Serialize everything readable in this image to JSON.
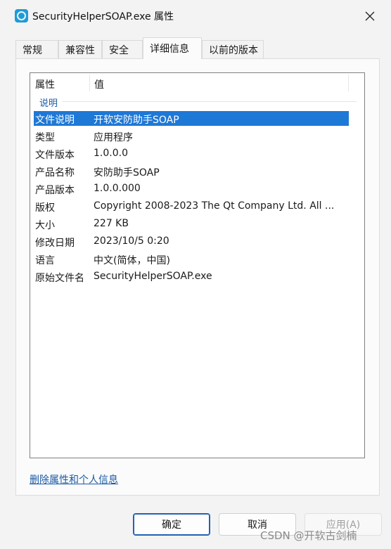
{
  "window": {
    "title": "SecurityHelperSOAP.exe 属性",
    "app_icon": "app-icon",
    "close_icon": "close-icon"
  },
  "tabs": [
    {
      "label": "常规"
    },
    {
      "label": "兼容性"
    },
    {
      "label": "安全"
    },
    {
      "label": "详细信息",
      "active": true
    },
    {
      "label": "以前的版本"
    }
  ],
  "details": {
    "columns": [
      "属性",
      "值"
    ],
    "group": "说明",
    "rows": [
      {
        "key": "文件说明",
        "value": "开软安防助手SOAP",
        "selected": true
      },
      {
        "key": "类型",
        "value": "应用程序"
      },
      {
        "key": "文件版本",
        "value": "1.0.0.0"
      },
      {
        "key": "产品名称",
        "value": "安防助手SOAP"
      },
      {
        "key": "产品版本",
        "value": "1.0.0.000"
      },
      {
        "key": "版权",
        "value": "Copyright 2008-2023 The Qt Company Ltd. All ..."
      },
      {
        "key": "大小",
        "value": "227 KB"
      },
      {
        "key": "修改日期",
        "value": "2023/10/5 0:20"
      },
      {
        "key": "语言",
        "value": "中文(简体，中国)"
      },
      {
        "key": "原始文件名",
        "value": "SecurityHelperSOAP.exe"
      }
    ]
  },
  "remove_link": "删除属性和个人信息",
  "buttons": {
    "ok": "确定",
    "cancel": "取消",
    "apply": "应用(A)"
  },
  "watermark": "CSDN @开软古剑楠",
  "colors": {
    "selection": "#1e78d6",
    "link": "#1a5aa6",
    "default_button_border": "#1f63b5",
    "app_icon": "#1f9bd7"
  }
}
